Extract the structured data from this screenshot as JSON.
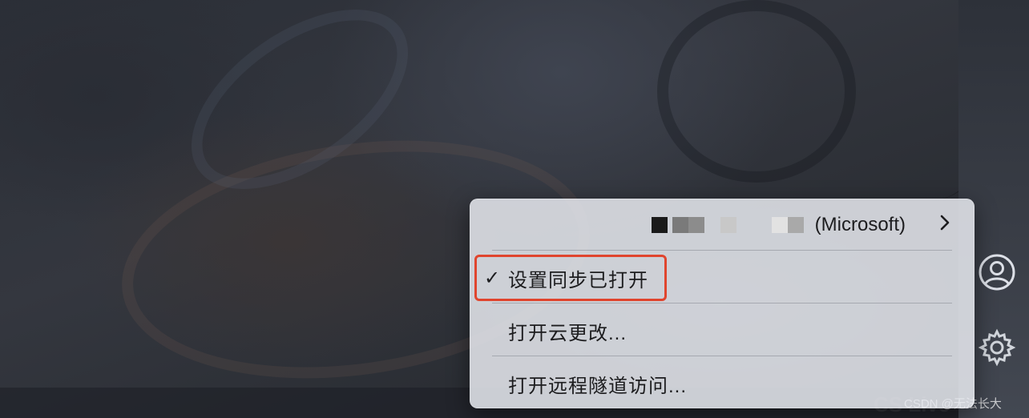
{
  "menu": {
    "account": {
      "label": "(Microsoft)",
      "redaction_colors": [
        "#1a1a1a",
        "#7a7a7a",
        "#8c8c8c",
        "#c8c8c8",
        "#e2e2e2",
        "#a9a9a9"
      ]
    },
    "sync_item": {
      "check_glyph": "✓",
      "label": "设置同步已打开",
      "checked": true
    },
    "cloud_changes_label": "打开云更改...",
    "remote_tunnel_label": "打开远程隧道访问..."
  },
  "side_bar": {
    "account_icon": "account-icon",
    "settings_icon": "gear-icon"
  },
  "watermark": {
    "text": "CSDN @无法长大"
  },
  "colors": {
    "highlight": "#e0452e",
    "menu_background": "#e8eaf0"
  }
}
